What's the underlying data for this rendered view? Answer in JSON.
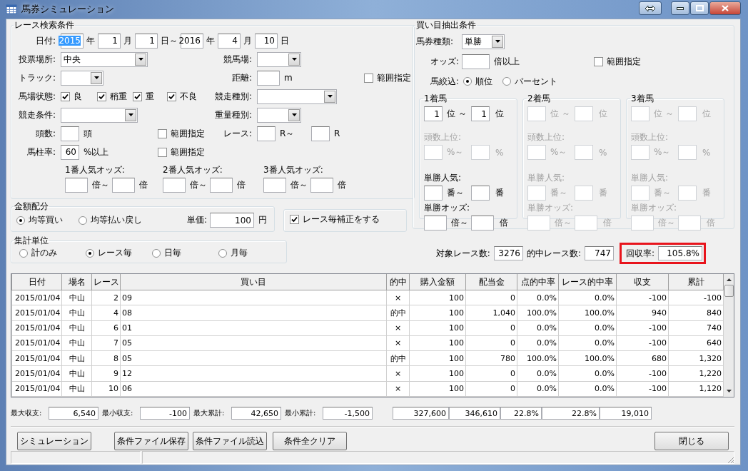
{
  "window": {
    "title": "馬券シミュレーション"
  },
  "search": {
    "title": "レース検索条件",
    "date": {
      "label": "日付:",
      "parts": [
        {
          "value": "2015",
          "unit": "年",
          "selected": true
        },
        {
          "value": "1",
          "unit": "月",
          "selected": false
        },
        {
          "value": "1",
          "unit": "日～",
          "selected": false
        },
        {
          "value": "2016",
          "unit": "年",
          "selected": false
        },
        {
          "value": "4",
          "unit": "月",
          "selected": false
        },
        {
          "value": "10",
          "unit": "日",
          "selected": false
        }
      ]
    },
    "venue": {
      "label": "投票場所:",
      "value": "中央"
    },
    "course": {
      "label": "競馬場:"
    },
    "track": {
      "label": "トラック:"
    },
    "distance": {
      "label": "距離:",
      "unit": "m"
    },
    "distance_range": {
      "label": "範囲指定",
      "checked": false
    },
    "going": {
      "label": "馬場状態:",
      "options": [
        {
          "label": "良",
          "checked": true
        },
        {
          "label": "稍重",
          "checked": true
        },
        {
          "label": "重",
          "checked": true
        },
        {
          "label": "不良",
          "checked": true
        }
      ]
    },
    "race_type": {
      "label": "競走種別:"
    },
    "race_condition": {
      "label": "競走条件:"
    },
    "weight_type": {
      "label": "重量種別:"
    },
    "runners": {
      "label": "頭数:",
      "unit": "頭"
    },
    "runners_range": {
      "label": "範囲指定",
      "checked": false
    },
    "race_no": {
      "label": "レース:",
      "unit_from": "R～",
      "unit_to": "R"
    },
    "ratio": {
      "label": "馬柱率:",
      "value": "60",
      "unit": "%以上"
    },
    "ratio_range": {
      "label": "範囲指定",
      "checked": false
    },
    "favorite_odds": [
      {
        "label": "1番人気オッズ:",
        "unit_from": "倍～",
        "unit_to": "倍"
      },
      {
        "label": "2番人気オッズ:",
        "unit_from": "倍～",
        "unit_to": "倍"
      },
      {
        "label": "3番人気オッズ:",
        "unit_from": "倍～",
        "unit_to": "倍"
      }
    ]
  },
  "bet": {
    "title": "買い目抽出条件",
    "ticket": {
      "label": "馬券種類:",
      "value": "単勝"
    },
    "odds": {
      "label": "オッズ:",
      "unit": "倍以上"
    },
    "odds_range": {
      "label": "範囲指定",
      "checked": false
    },
    "filter": {
      "label": "馬絞込:",
      "options": [
        {
          "label": "順位",
          "selected": true
        },
        {
          "label": "パーセント",
          "selected": false
        }
      ]
    },
    "places": [
      {
        "title": "1着馬",
        "rows": [
          {
            "from": "1",
            "unit_from": "位 ～",
            "to": "1",
            "unit_to": "位",
            "disabled": false
          },
          {
            "label": "頭数上位:",
            "unit_from": "%～",
            "unit_to": "%",
            "disabled": true
          },
          {
            "label": "単勝人気:",
            "unit_from": "番～",
            "unit_to": "番",
            "disabled": false
          },
          {
            "label": "単勝オッズ:",
            "unit_from": "倍～",
            "unit_to": "倍",
            "disabled": false
          }
        ]
      },
      {
        "title": "2着馬",
        "rows": [
          {
            "unit_from": "位 ～",
            "unit_to": "位",
            "disabled": true
          },
          {
            "label": "頭数上位:",
            "unit_from": "%～",
            "unit_to": "%",
            "disabled": true
          },
          {
            "label": "単勝人気:",
            "unit_from": "番～",
            "unit_to": "番",
            "disabled": true
          },
          {
            "label": "単勝オッズ:",
            "unit_from": "倍～",
            "unit_to": "倍",
            "disabled": true
          }
        ]
      },
      {
        "title": "3着馬",
        "rows": [
          {
            "unit_from": "位 ～",
            "unit_to": "位",
            "disabled": true
          },
          {
            "label": "頭数上位:",
            "unit_from": "%～",
            "unit_to": "%",
            "disabled": true
          },
          {
            "label": "単勝人気:",
            "unit_from": "番～",
            "unit_to": "番",
            "disabled": true
          },
          {
            "label": "単勝オッズ:",
            "unit_from": "倍～",
            "unit_to": "倍",
            "disabled": true
          }
        ]
      }
    ]
  },
  "amount": {
    "title": "金額配分",
    "options": [
      {
        "label": "均等買い",
        "selected": true
      },
      {
        "label": "均等払い戻し",
        "selected": false
      }
    ],
    "price": {
      "label": "単価:",
      "value": "100",
      "unit": "円"
    }
  },
  "correction": {
    "label": "レース毎補正をする",
    "checked": true
  },
  "aggregation": {
    "title": "集計単位",
    "options": [
      {
        "label": "計のみ",
        "selected": false
      },
      {
        "label": "レース毎",
        "selected": true
      },
      {
        "label": "日毎",
        "selected": false
      },
      {
        "label": "月毎",
        "selected": false
      }
    ]
  },
  "stats": [
    {
      "label": "対象レース数:",
      "value": "3276",
      "highlighted": false
    },
    {
      "label": "的中レース数:",
      "value": "747",
      "highlighted": false
    },
    {
      "label": "回収率:",
      "value": "105.8%",
      "highlighted": true
    }
  ],
  "table": {
    "columns": [
      "日付",
      "場名",
      "レース",
      "買い目",
      "的中",
      "購入金額",
      "配当金",
      "点的中率",
      "レース的中率",
      "収支",
      "累計"
    ],
    "rows": [
      [
        "2015/01/04",
        "中山",
        "2",
        "09",
        "×",
        "100",
        "0",
        "0.0%",
        "0.0%",
        "-100",
        "-100"
      ],
      [
        "2015/01/04",
        "中山",
        "4",
        "08",
        "的中",
        "100",
        "1,040",
        "100.0%",
        "100.0%",
        "940",
        "840"
      ],
      [
        "2015/01/04",
        "中山",
        "6",
        "01",
        "×",
        "100",
        "0",
        "0.0%",
        "0.0%",
        "-100",
        "740"
      ],
      [
        "2015/01/04",
        "中山",
        "7",
        "05",
        "×",
        "100",
        "0",
        "0.0%",
        "0.0%",
        "-100",
        "640"
      ],
      [
        "2015/01/04",
        "中山",
        "8",
        "05",
        "的中",
        "100",
        "780",
        "100.0%",
        "100.0%",
        "680",
        "1,320"
      ],
      [
        "2015/01/04",
        "中山",
        "9",
        "12",
        "×",
        "100",
        "0",
        "0.0%",
        "0.0%",
        "-100",
        "1,220"
      ],
      [
        "2015/01/04",
        "中山",
        "10",
        "06",
        "×",
        "100",
        "0",
        "0.0%",
        "0.0%",
        "-100",
        "1,120"
      ]
    ]
  },
  "summary": {
    "items": [
      {
        "label": "最大収支:",
        "value": "6,540"
      },
      {
        "label": "最小収支:",
        "value": "-100"
      },
      {
        "label": "最大累計:",
        "value": "42,650"
      },
      {
        "label": "最小累計:",
        "value": "-1,500"
      }
    ],
    "totals": [
      "327,600",
      "346,610",
      "22.8%",
      "22.8%",
      "19,010"
    ]
  },
  "buttons_left": [
    "シミュレーション",
    "条件ファイル保存",
    "条件ファイル読込",
    "条件全クリア"
  ],
  "buttons_right": [
    "閉じる"
  ]
}
